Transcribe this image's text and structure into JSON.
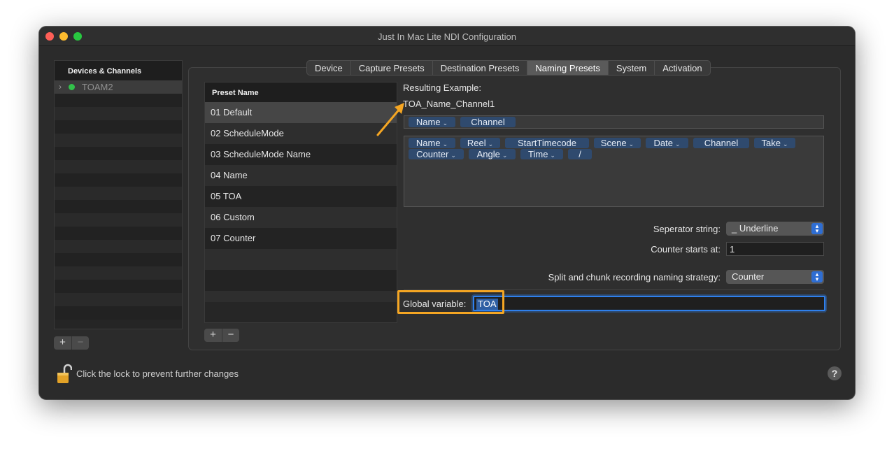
{
  "window": {
    "title": "Just In Mac Lite NDI Configuration"
  },
  "sidebar": {
    "header": "Devices & Channels",
    "device": {
      "label": "TOAM2",
      "status_color": "#32c14a"
    }
  },
  "tabs": [
    {
      "label": "Device"
    },
    {
      "label": "Capture Presets"
    },
    {
      "label": "Destination Presets"
    },
    {
      "label": "Naming Presets",
      "active": true
    },
    {
      "label": "System"
    },
    {
      "label": "Activation"
    }
  ],
  "presets": {
    "header": "Preset Name",
    "items": [
      "01 Default",
      "02 ScheduleMode",
      "03 ScheduleMode Name",
      "04 Name",
      "05 TOA",
      "06 Custom",
      "07 Counter"
    ],
    "selected_index": 0
  },
  "result": {
    "label": "Resulting Example:",
    "value": "TOA_Name_Channel1"
  },
  "active_tokens": [
    {
      "label": "Name",
      "dropdown": true
    },
    {
      "label": "Channel",
      "dropdown": false
    }
  ],
  "available_tokens": [
    {
      "label": "Name",
      "dropdown": true
    },
    {
      "label": "Reel",
      "dropdown": true
    },
    {
      "label": "StartTimecode",
      "dropdown": false
    },
    {
      "label": "Scene",
      "dropdown": true
    },
    {
      "label": "Date",
      "dropdown": true
    },
    {
      "label": "Channel",
      "dropdown": false
    },
    {
      "label": "Take",
      "dropdown": true
    },
    {
      "label": "Counter",
      "dropdown": true
    },
    {
      "label": "Angle",
      "dropdown": true
    },
    {
      "label": "Time",
      "dropdown": true
    },
    {
      "label": "/",
      "dropdown": false
    }
  ],
  "settings": {
    "separator_label": "Seperator string:",
    "separator_value": "_ Underline",
    "counter_label": "Counter starts at:",
    "counter_value": "1",
    "split_label": "Split and chunk recording naming strategy:",
    "split_value": "Counter",
    "global_label": "Global variable:",
    "global_value": "TOA"
  },
  "footer": {
    "lock_text": "Click the lock to prevent further changes",
    "help": "?",
    "plus": "+",
    "minus": "−"
  },
  "colors": {
    "accent": "#2f80ed",
    "highlight": "#f5a623",
    "token": "#2f4a6e"
  }
}
